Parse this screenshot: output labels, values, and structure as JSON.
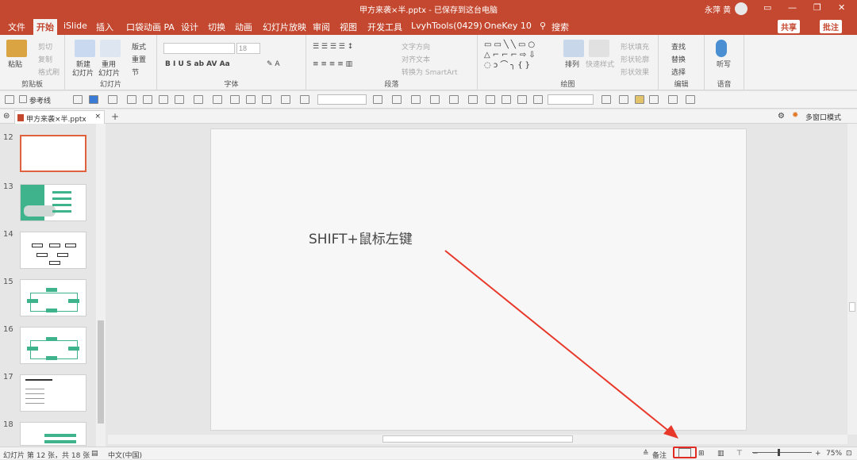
{
  "titlebar": {
    "title": "甲方来袭×半.pptx - 已保存到这台电脑",
    "user": "永萍 黄",
    "min": "—",
    "restore": "❐",
    "close": "✕",
    "layout": "▭"
  },
  "tabs": [
    {
      "label": "文件"
    },
    {
      "label": "开始"
    },
    {
      "label": "iSlide"
    },
    {
      "label": "插入"
    },
    {
      "label": "口袋动画 PA"
    },
    {
      "label": "设计"
    },
    {
      "label": "切换"
    },
    {
      "label": "动画"
    },
    {
      "label": "幻灯片放映"
    },
    {
      "label": "审阅"
    },
    {
      "label": "视图"
    },
    {
      "label": "开发工具"
    },
    {
      "label": "LvyhTools(0429)"
    },
    {
      "label": "OneKey 10"
    },
    {
      "label": "搜索"
    }
  ],
  "share": "共享",
  "comment": "批注",
  "ribbon": {
    "clipboard": {
      "paste": "粘贴",
      "cut": "剪切",
      "copy": "复制",
      "format_painter": "格式刷",
      "label": "剪贴板"
    },
    "slides": {
      "new": "新建",
      "new2": "幻灯片",
      "reuse": "重用",
      "reuse2": "幻灯片",
      "layout": "版式",
      "reset": "重置",
      "section": "节",
      "label": "幻灯片"
    },
    "font": {
      "size": "18",
      "label": "字体"
    },
    "paragraph": {
      "text_dir": "文字方向",
      "align_text": "对齐文本",
      "smartart": "转换为 SmartArt",
      "label": "段落"
    },
    "drawing": {
      "arrange": "排列",
      "quick_styles": "快速样式",
      "fill": "形状填充",
      "outline": "形状轮廓",
      "effects": "形状效果",
      "label": "绘图"
    },
    "editing": {
      "find": "查找",
      "replace": "替换",
      "select": "选择",
      "label": "编辑"
    },
    "voice": {
      "dictate": "听写",
      "label": "语音"
    }
  },
  "qat": {
    "gridlines": "参考线"
  },
  "doc_tab": "甲方来袭×半.pptx",
  "multi_window": "多窗口模式",
  "slides": [
    {
      "num": "12"
    },
    {
      "num": "13"
    },
    {
      "num": "14"
    },
    {
      "num": "15"
    },
    {
      "num": "16"
    },
    {
      "num": "17"
    },
    {
      "num": "18"
    }
  ],
  "slide_text": "SHIFT+鼠标左键",
  "status": {
    "slide_info": "幻灯片 第 12 张，共 18 张",
    "language": "中文(中国)",
    "notes": "备注",
    "zoom": "75%"
  },
  "colors": {
    "accent": "#c4482f",
    "highlight": "#e02c24",
    "arrow": "#e8382a"
  }
}
